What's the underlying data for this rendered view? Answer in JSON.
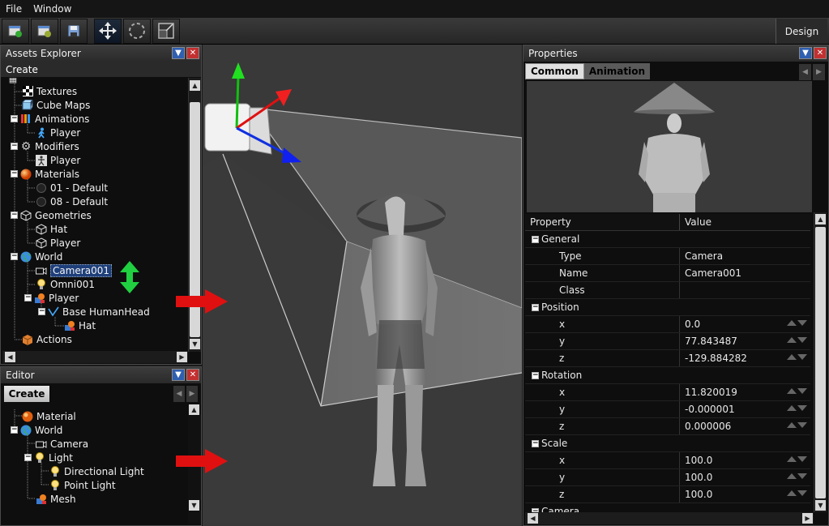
{
  "menu": {
    "file": "File",
    "window": "Window"
  },
  "toolbar": {
    "design": "Design"
  },
  "assets": {
    "title": "Assets Explorer",
    "create": "Create",
    "items": [
      "Textures",
      "Cube Maps",
      "Animations",
      "Player",
      "Modifiers",
      "Player",
      "Materials",
      "01 - Default",
      "08 - Default",
      "Geometries",
      "Hat",
      "Player",
      "World",
      "Camera001",
      "Omni001",
      "Player",
      "Base HumanHead",
      "Hat",
      "Actions"
    ]
  },
  "editor": {
    "title": "Editor",
    "create": "Create",
    "items": [
      "Material",
      "World",
      "Camera",
      "Light",
      "Directional Light",
      "Point Light",
      "Mesh"
    ]
  },
  "properties": {
    "title": "Properties",
    "tabs": [
      "Common",
      "Animation"
    ],
    "header": {
      "property": "Property",
      "value": "Value"
    },
    "rows": [
      {
        "kind": "group",
        "label": "General"
      },
      {
        "kind": "item",
        "label": "Type",
        "value": "Camera",
        "spin": false
      },
      {
        "kind": "item",
        "label": "Name",
        "value": "Camera001",
        "spin": false
      },
      {
        "kind": "item",
        "label": "Class",
        "value": "",
        "spin": false
      },
      {
        "kind": "group",
        "label": "Position"
      },
      {
        "kind": "item",
        "label": "x",
        "value": "0.0",
        "spin": true
      },
      {
        "kind": "item",
        "label": "y",
        "value": "77.843487",
        "spin": true
      },
      {
        "kind": "item",
        "label": "z",
        "value": "-129.884282",
        "spin": true
      },
      {
        "kind": "group",
        "label": "Rotation"
      },
      {
        "kind": "item",
        "label": "x",
        "value": "11.820019",
        "spin": true
      },
      {
        "kind": "item",
        "label": "y",
        "value": "-0.000001",
        "spin": true
      },
      {
        "kind": "item",
        "label": "z",
        "value": "0.000006",
        "spin": true
      },
      {
        "kind": "group",
        "label": "Scale"
      },
      {
        "kind": "item",
        "label": "x",
        "value": "100.0",
        "spin": true
      },
      {
        "kind": "item",
        "label": "y",
        "value": "100.0",
        "spin": true
      },
      {
        "kind": "item",
        "label": "z",
        "value": "100.0",
        "spin": true
      },
      {
        "kind": "group",
        "label": "Camera"
      }
    ]
  },
  "colors": {
    "accent": "#2f5fb0",
    "close": "#c23030",
    "selection": "#1e3f7a",
    "arrow_red": "#e01010",
    "arrow_green": "#20d040"
  }
}
